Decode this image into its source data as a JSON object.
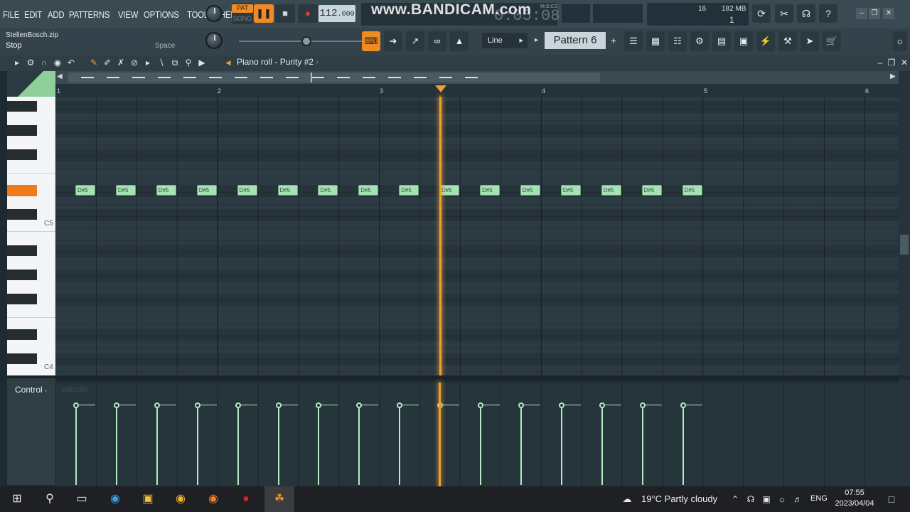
{
  "menu": {
    "file": "FILE",
    "edit": "EDIT",
    "add": "ADD",
    "patterns": "PATTERNS",
    "view": "VIEW",
    "options": "OPTIONS",
    "tools": "TOOLS",
    "help": "HELP"
  },
  "transport": {
    "pat": "PAT",
    "song": "SONG",
    "tempo_int": "112",
    "tempo_dec": ".000",
    "time": "0:05:08",
    "time_unit": "M:S:CS"
  },
  "watermark": "www.BANDICAM.com",
  "stats": {
    "polyphony": "16",
    "memory": "182 MB",
    "cpu": "1"
  },
  "hint": {
    "file": "StellenBosch.zip",
    "action": "Stop",
    "shortcut": "Space"
  },
  "snap": "Line",
  "pattern": "Pattern 6",
  "pattern_plus": "+",
  "pianoroll": {
    "title": "Piano roll - Purity #2",
    "arrow": "›"
  },
  "ruler": [
    "1",
    "2",
    "3",
    "4",
    "5",
    "6"
  ],
  "octaves": [
    "C5",
    "C4"
  ],
  "note_label": "D#5",
  "notes": [
    1,
    2,
    3,
    4,
    5,
    6,
    7,
    8,
    9,
    10,
    11,
    12,
    13,
    14,
    15,
    16
  ],
  "control": {
    "label": "Control",
    "arrow": "›",
    "target": "Velocity"
  },
  "taskbar": {
    "weather": "19°C  Partly cloudy",
    "lang": "ENG",
    "time": "07:55",
    "date": "2023/04/04"
  },
  "colors": {
    "accent": "#f0a030",
    "note": "#a6e3b4",
    "active_key": "#f07a1a"
  },
  "icons": [
    "windows-start-icon",
    "search-icon",
    "task-view-icon",
    "edge-icon",
    "file-explorer-icon",
    "chrome-icon",
    "firefox-icon",
    "bandicam-record-icon",
    "fl-studio-icon"
  ]
}
